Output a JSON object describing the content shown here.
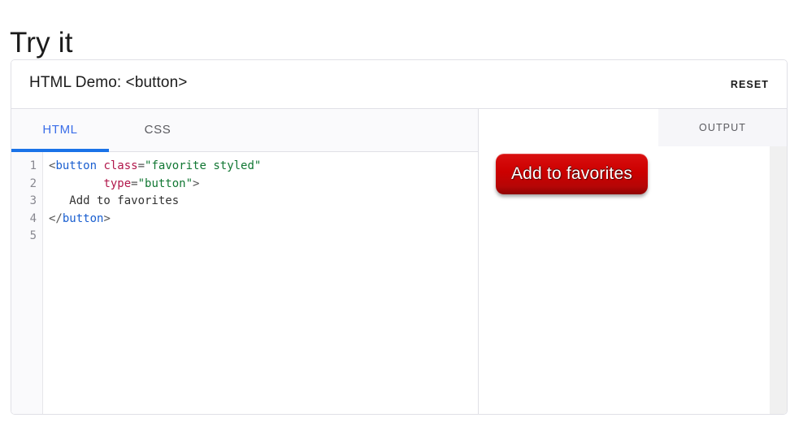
{
  "page": {
    "title": "Try it"
  },
  "demo": {
    "header_title": "HTML Demo: <button>",
    "reset_label": "RESET",
    "editor": {
      "tabs": [
        {
          "label": "HTML",
          "active": true
        },
        {
          "label": "CSS",
          "active": false
        }
      ],
      "line_numbers": [
        "1",
        "2",
        "3",
        "4",
        "5"
      ],
      "code_lines": [
        {
          "tokens": [
            {
              "type": "punct",
              "text": "<"
            },
            {
              "type": "tag",
              "text": "button"
            },
            {
              "type": "text",
              "text": " "
            },
            {
              "type": "attr",
              "text": "class"
            },
            {
              "type": "punct",
              "text": "="
            },
            {
              "type": "val",
              "text": "\"favorite styled\""
            }
          ]
        },
        {
          "tokens": [
            {
              "type": "text",
              "text": "        "
            },
            {
              "type": "attr",
              "text": "type"
            },
            {
              "type": "punct",
              "text": "="
            },
            {
              "type": "val",
              "text": "\"button\""
            },
            {
              "type": "punct",
              "text": ">"
            }
          ]
        },
        {
          "tokens": [
            {
              "type": "text",
              "text": "   Add to favorites"
            }
          ]
        },
        {
          "tokens": [
            {
              "type": "punct",
              "text": "</"
            },
            {
              "type": "tag",
              "text": "button"
            },
            {
              "type": "punct",
              "text": ">"
            }
          ]
        },
        {
          "tokens": []
        }
      ],
      "code_plain": "<button class=\"favorite styled\"\n        type=\"button\">\n   Add to favorites\n</button>\n"
    },
    "output": {
      "tab_label": "OUTPUT",
      "button_label": "Add to favorites"
    }
  },
  "colors": {
    "accent_tab": "#1a73e8",
    "active_tab_text": "#3b6ee8",
    "button_red_top": "#d91010",
    "button_red_bottom": "#8f0303",
    "card_border": "#e0e0e6",
    "panel_bg": "#fafafc",
    "output_tab_bg": "#f6f6f9",
    "scrollbar_track": "#f0f0f0",
    "token_tag": "#1a5fd0",
    "token_attr": "#b1174b",
    "token_value": "#117733",
    "token_punct": "#555555"
  }
}
